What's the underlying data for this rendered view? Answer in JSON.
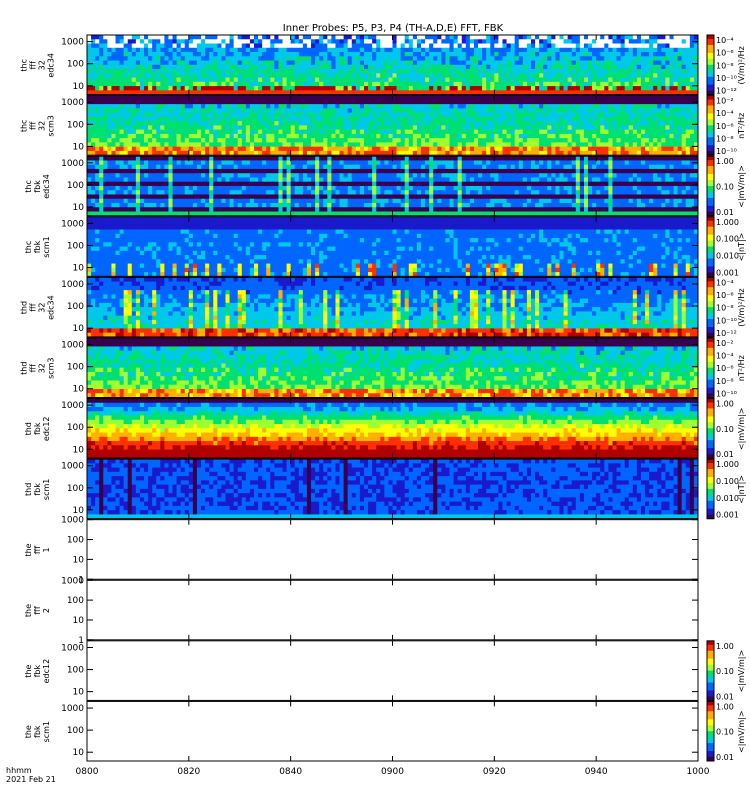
{
  "title": "Inner Probes: P5, P3, P4 (TH-A,D,E) FFT, FBK",
  "footer": {
    "line1": "hhmm",
    "line2": "2021 Feb 21"
  },
  "colors": [
    "#3a0050",
    "#1a1acc",
    "#0066ff",
    "#00c8e8",
    "#00e070",
    "#a0ff30",
    "#ffff00",
    "#ffb000",
    "#ff3000",
    "#b00000"
  ],
  "chart_data": {
    "type": "heatmap",
    "title": "Inner Probes: P5, P3, P4 (TH-A,D,E) FFT, FBK",
    "x_ticks": [
      "0800",
      "0820",
      "0840",
      "0900",
      "0920",
      "0940",
      "1000"
    ],
    "panels": [
      {
        "id": "thc-fff32-edc34",
        "ylabel": [
          "thc",
          "fff",
          "32",
          "edc34"
        ],
        "y_ticks": [
          "1000",
          "100",
          "10"
        ],
        "ylim": [
          4,
          2000
        ],
        "log": true,
        "fill": "noisy",
        "colorbar": {
          "labels": [
            "10⁻⁴",
            "10⁻⁶",
            "10⁻⁸",
            "10⁻¹⁰",
            "10⁻¹²"
          ],
          "unit": "(V/m)²/Hz"
        }
      },
      {
        "id": "thc-fff32-scm3",
        "ylabel": [
          "thc",
          "fff",
          "32",
          "scm3"
        ],
        "y_ticks": [
          "1000",
          "100",
          "10"
        ],
        "ylim": [
          4,
          2000
        ],
        "log": true,
        "fill": "noisy2",
        "colorbar": {
          "labels": [
            "10⁻²",
            "10⁻⁴",
            "10⁻⁶",
            "10⁻⁸",
            "10⁻¹⁰"
          ],
          "unit": "nT²/Hz"
        }
      },
      {
        "id": "thc-fbk-edc34",
        "ylabel": [
          "thc",
          "fbk",
          "edc34"
        ],
        "y_ticks": [
          "1000",
          "100",
          "10"
        ],
        "ylim": [
          4,
          2000
        ],
        "log": true,
        "fill": "bands",
        "colorbar": {
          "labels": [
            "1.00",
            "0.10",
            "0.01"
          ],
          "unit": "<|mV/m|>"
        }
      },
      {
        "id": "thc-fbk-scm1",
        "ylabel": [
          "thc",
          "fbk",
          "scm1"
        ],
        "y_ticks": [
          "1000",
          "100",
          "10"
        ],
        "ylim": [
          4,
          2000
        ],
        "log": true,
        "fill": "bands2",
        "colorbar": {
          "labels": [
            "1.000",
            "0.100",
            "0.010",
            "0.001"
          ],
          "unit": "<|nT|>"
        }
      },
      {
        "id": "thd-fff32-edc34",
        "ylabel": [
          "thd",
          "fff",
          "32",
          "edc34"
        ],
        "y_ticks": [
          "1000",
          "100",
          "10"
        ],
        "ylim": [
          4,
          2000
        ],
        "log": true,
        "fill": "spiky",
        "colorbar": {
          "labels": [
            "10⁻⁴",
            "10⁻⁶",
            "10⁻⁸",
            "10⁻¹⁰",
            "10⁻¹²"
          ],
          "unit": "(V/m)²/Hz"
        }
      },
      {
        "id": "thd-fff32-scm3",
        "ylabel": [
          "thd",
          "fff",
          "32",
          "scm3"
        ],
        "y_ticks": [
          "1000",
          "100",
          "10"
        ],
        "ylim": [
          4,
          2000
        ],
        "log": true,
        "fill": "noisy2",
        "colorbar": {
          "labels": [
            "10⁻²",
            "10⁻⁴",
            "10⁻⁶",
            "10⁻⁸",
            "10⁻¹⁰"
          ],
          "unit": "nT²/Hz"
        }
      },
      {
        "id": "thd-fbk-edc12",
        "ylabel": [
          "thd",
          "fbk",
          "edc12"
        ],
        "y_ticks": [
          "1000",
          "100",
          "10"
        ],
        "ylim": [
          4,
          2000
        ],
        "log": true,
        "fill": "hot",
        "colorbar": {
          "labels": [
            "1.00",
            "0.10",
            "0.01"
          ],
          "unit": "<|mV/m|>"
        }
      },
      {
        "id": "thd-fbk-scm1",
        "ylabel": [
          "thd",
          "fbk",
          "scm1"
        ],
        "y_ticks": [
          "1000",
          "100",
          "10"
        ],
        "ylim": [
          4,
          2000
        ],
        "log": true,
        "fill": "blue",
        "colorbar": {
          "labels": [
            "1.000",
            "0.100",
            "0.010",
            "0.001"
          ],
          "unit": "<|nT|>"
        }
      },
      {
        "id": "the-fff-1",
        "ylabel": [
          "the",
          "fff",
          "1"
        ],
        "y_ticks": [
          "1000",
          "100",
          "10",
          "1"
        ],
        "ylim": [
          1,
          1000
        ],
        "log": true,
        "fill": "empty"
      },
      {
        "id": "the-fff-2",
        "ylabel": [
          "the",
          "fff",
          "2"
        ],
        "y_ticks": [
          "1000",
          "100",
          "10",
          "1"
        ],
        "ylim": [
          1,
          1000
        ],
        "log": true,
        "fill": "empty"
      },
      {
        "id": "the-fbk-edc12",
        "ylabel": [
          "the",
          "fbk",
          "edc12"
        ],
        "y_ticks": [
          "1000",
          "100",
          "10"
        ],
        "ylim": [
          4,
          2000
        ],
        "log": true,
        "fill": "empty",
        "colorbar": {
          "labels": [
            "1.00",
            "0.10",
            "0.01"
          ],
          "unit": "<|mV/m|>"
        }
      },
      {
        "id": "the-fbk-scm1",
        "ylabel": [
          "the",
          "fbk",
          "scm1"
        ],
        "y_ticks": [
          "1000",
          "100",
          "10"
        ],
        "ylim": [
          4,
          2000
        ],
        "log": true,
        "fill": "empty",
        "colorbar": {
          "labels": [
            "1.00",
            "0.10",
            "0.01"
          ],
          "unit": "<|mV/m|>"
        }
      }
    ]
  }
}
